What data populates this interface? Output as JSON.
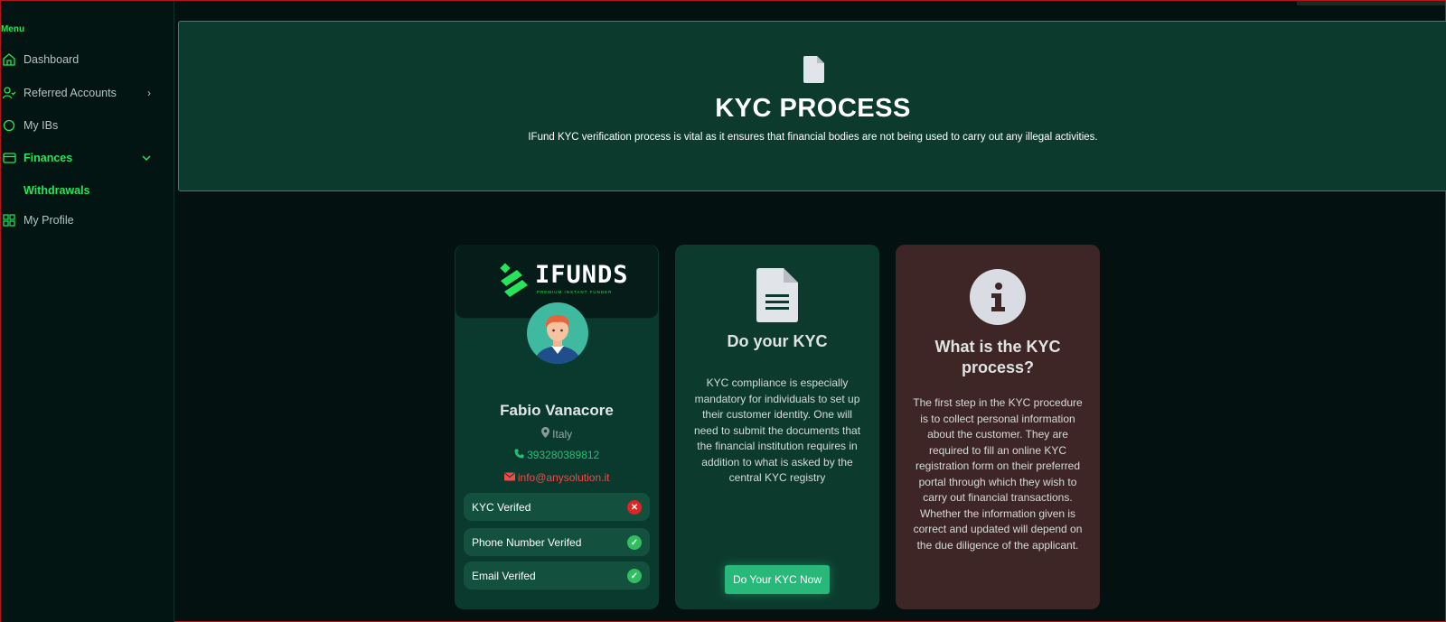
{
  "sidebar": {
    "menu_title": "Menu",
    "items": [
      {
        "label": "Dashboard",
        "icon": "home-icon"
      },
      {
        "label": "Referred Accounts",
        "icon": "user-check-icon"
      },
      {
        "label": "My IBs",
        "icon": "circle-icon"
      },
      {
        "label": "Finances",
        "icon": "card-icon"
      },
      {
        "label": "My Profile",
        "icon": "grid-icon"
      }
    ],
    "sub_item": "Withdrawals"
  },
  "banner": {
    "title": "KYC PROCESS",
    "subtitle": "IFund KYC verification process is vital as it ensures that financial bodies are not being used to carry out any illegal activities."
  },
  "profile": {
    "logo_text": "IFUNDS",
    "logo_tagline": "PREMIUM INSTANT FUNDER",
    "name": "Fabio Vanacore",
    "country": "Italy",
    "phone": "393280389812",
    "email": "info@anysolution.it",
    "statuses": [
      {
        "label": "KYC Verifed",
        "verified": false
      },
      {
        "label": "Phone Number Verifed",
        "verified": true
      },
      {
        "label": "Email Verifed",
        "verified": true
      }
    ]
  },
  "kyc_card": {
    "title": "Do your KYC",
    "body": "KYC compliance is especially mandatory for individuals to set up their customer identity. One will need to submit the documents that the financial institution requires in addition to what is asked by the central KYC registry",
    "button": "Do Your KYC Now"
  },
  "info_card": {
    "title": "What is the KYC process?",
    "body": "The first step in the KYC procedure is to collect personal information about the customer. They are required to fill an online KYC registration form on their preferred portal through which they wish to carry out financial transactions. Whether the information given is correct and updated will depend on the due diligence of the applicant."
  },
  "colors": {
    "accent": "#27e45a",
    "background": "#031210",
    "banner": "#0c3b2e",
    "info_card": "#3e2626",
    "error": "#e02424"
  }
}
